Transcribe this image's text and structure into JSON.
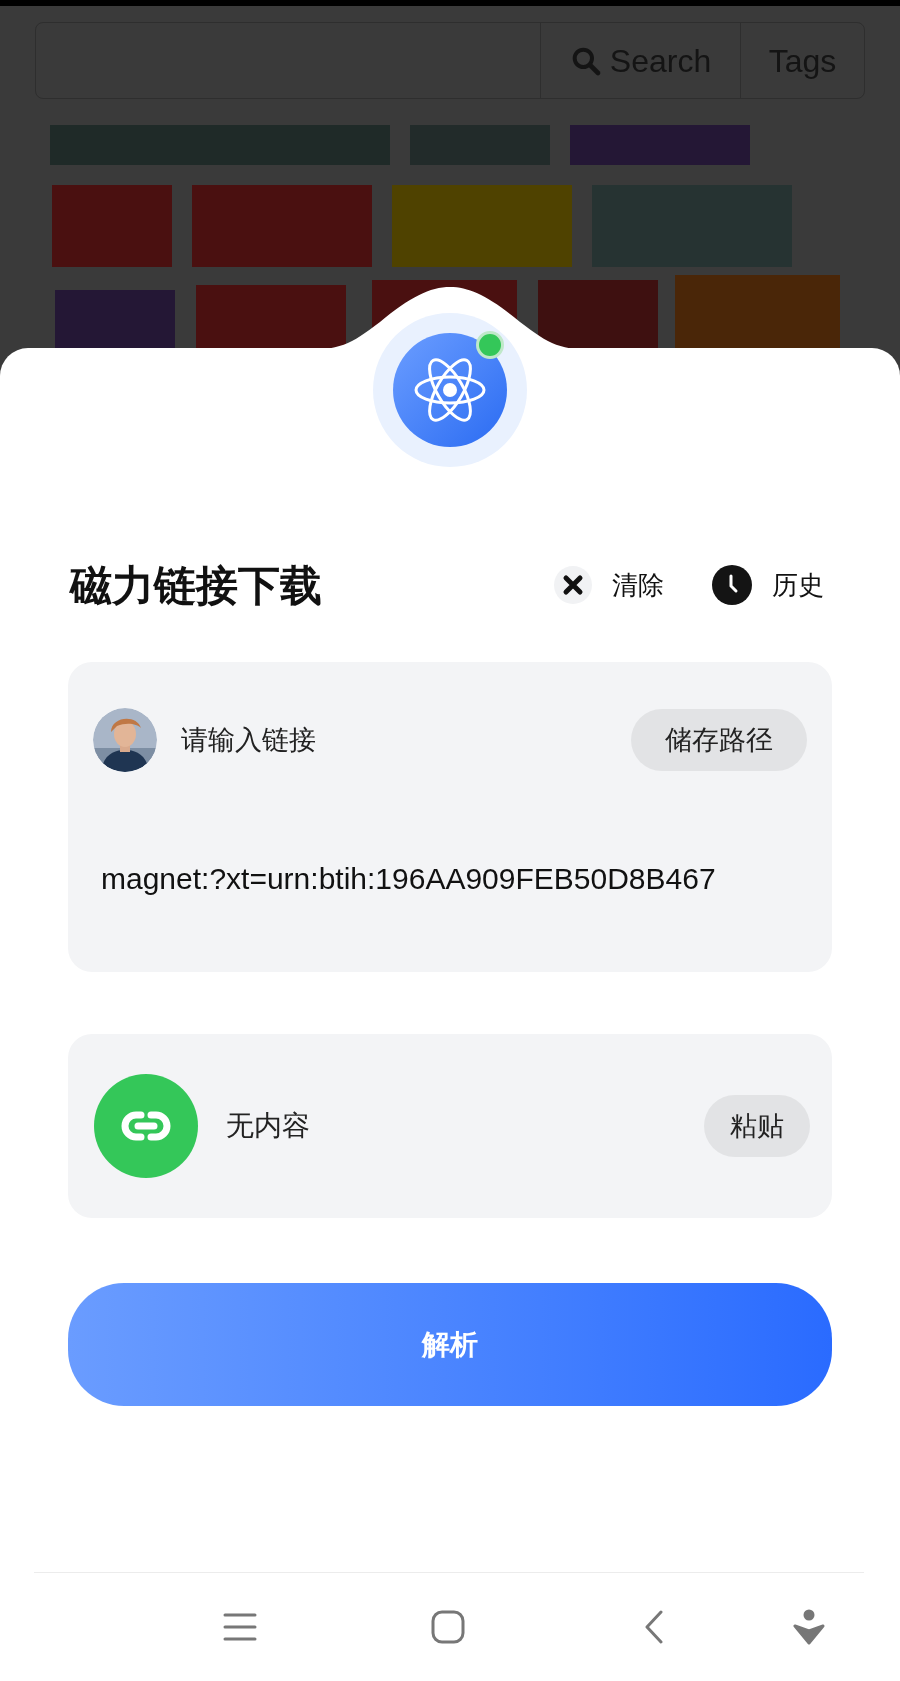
{
  "search_bar": {
    "search_button": "Search",
    "tags_button": "Tags"
  },
  "sheet": {
    "title": "磁力链接下载",
    "actions": [
      {
        "kind": "clear",
        "label": "清除"
      },
      {
        "kind": "history",
        "label": "历史"
      }
    ],
    "link_card": {
      "label": "请输入链接",
      "button": "储存路径",
      "value": "magnet:?xt=urn:btih:196AA909FEB50D8B467"
    },
    "clipboard_card": {
      "text": "无内容",
      "button": "粘贴"
    },
    "submit_button": "解析"
  }
}
